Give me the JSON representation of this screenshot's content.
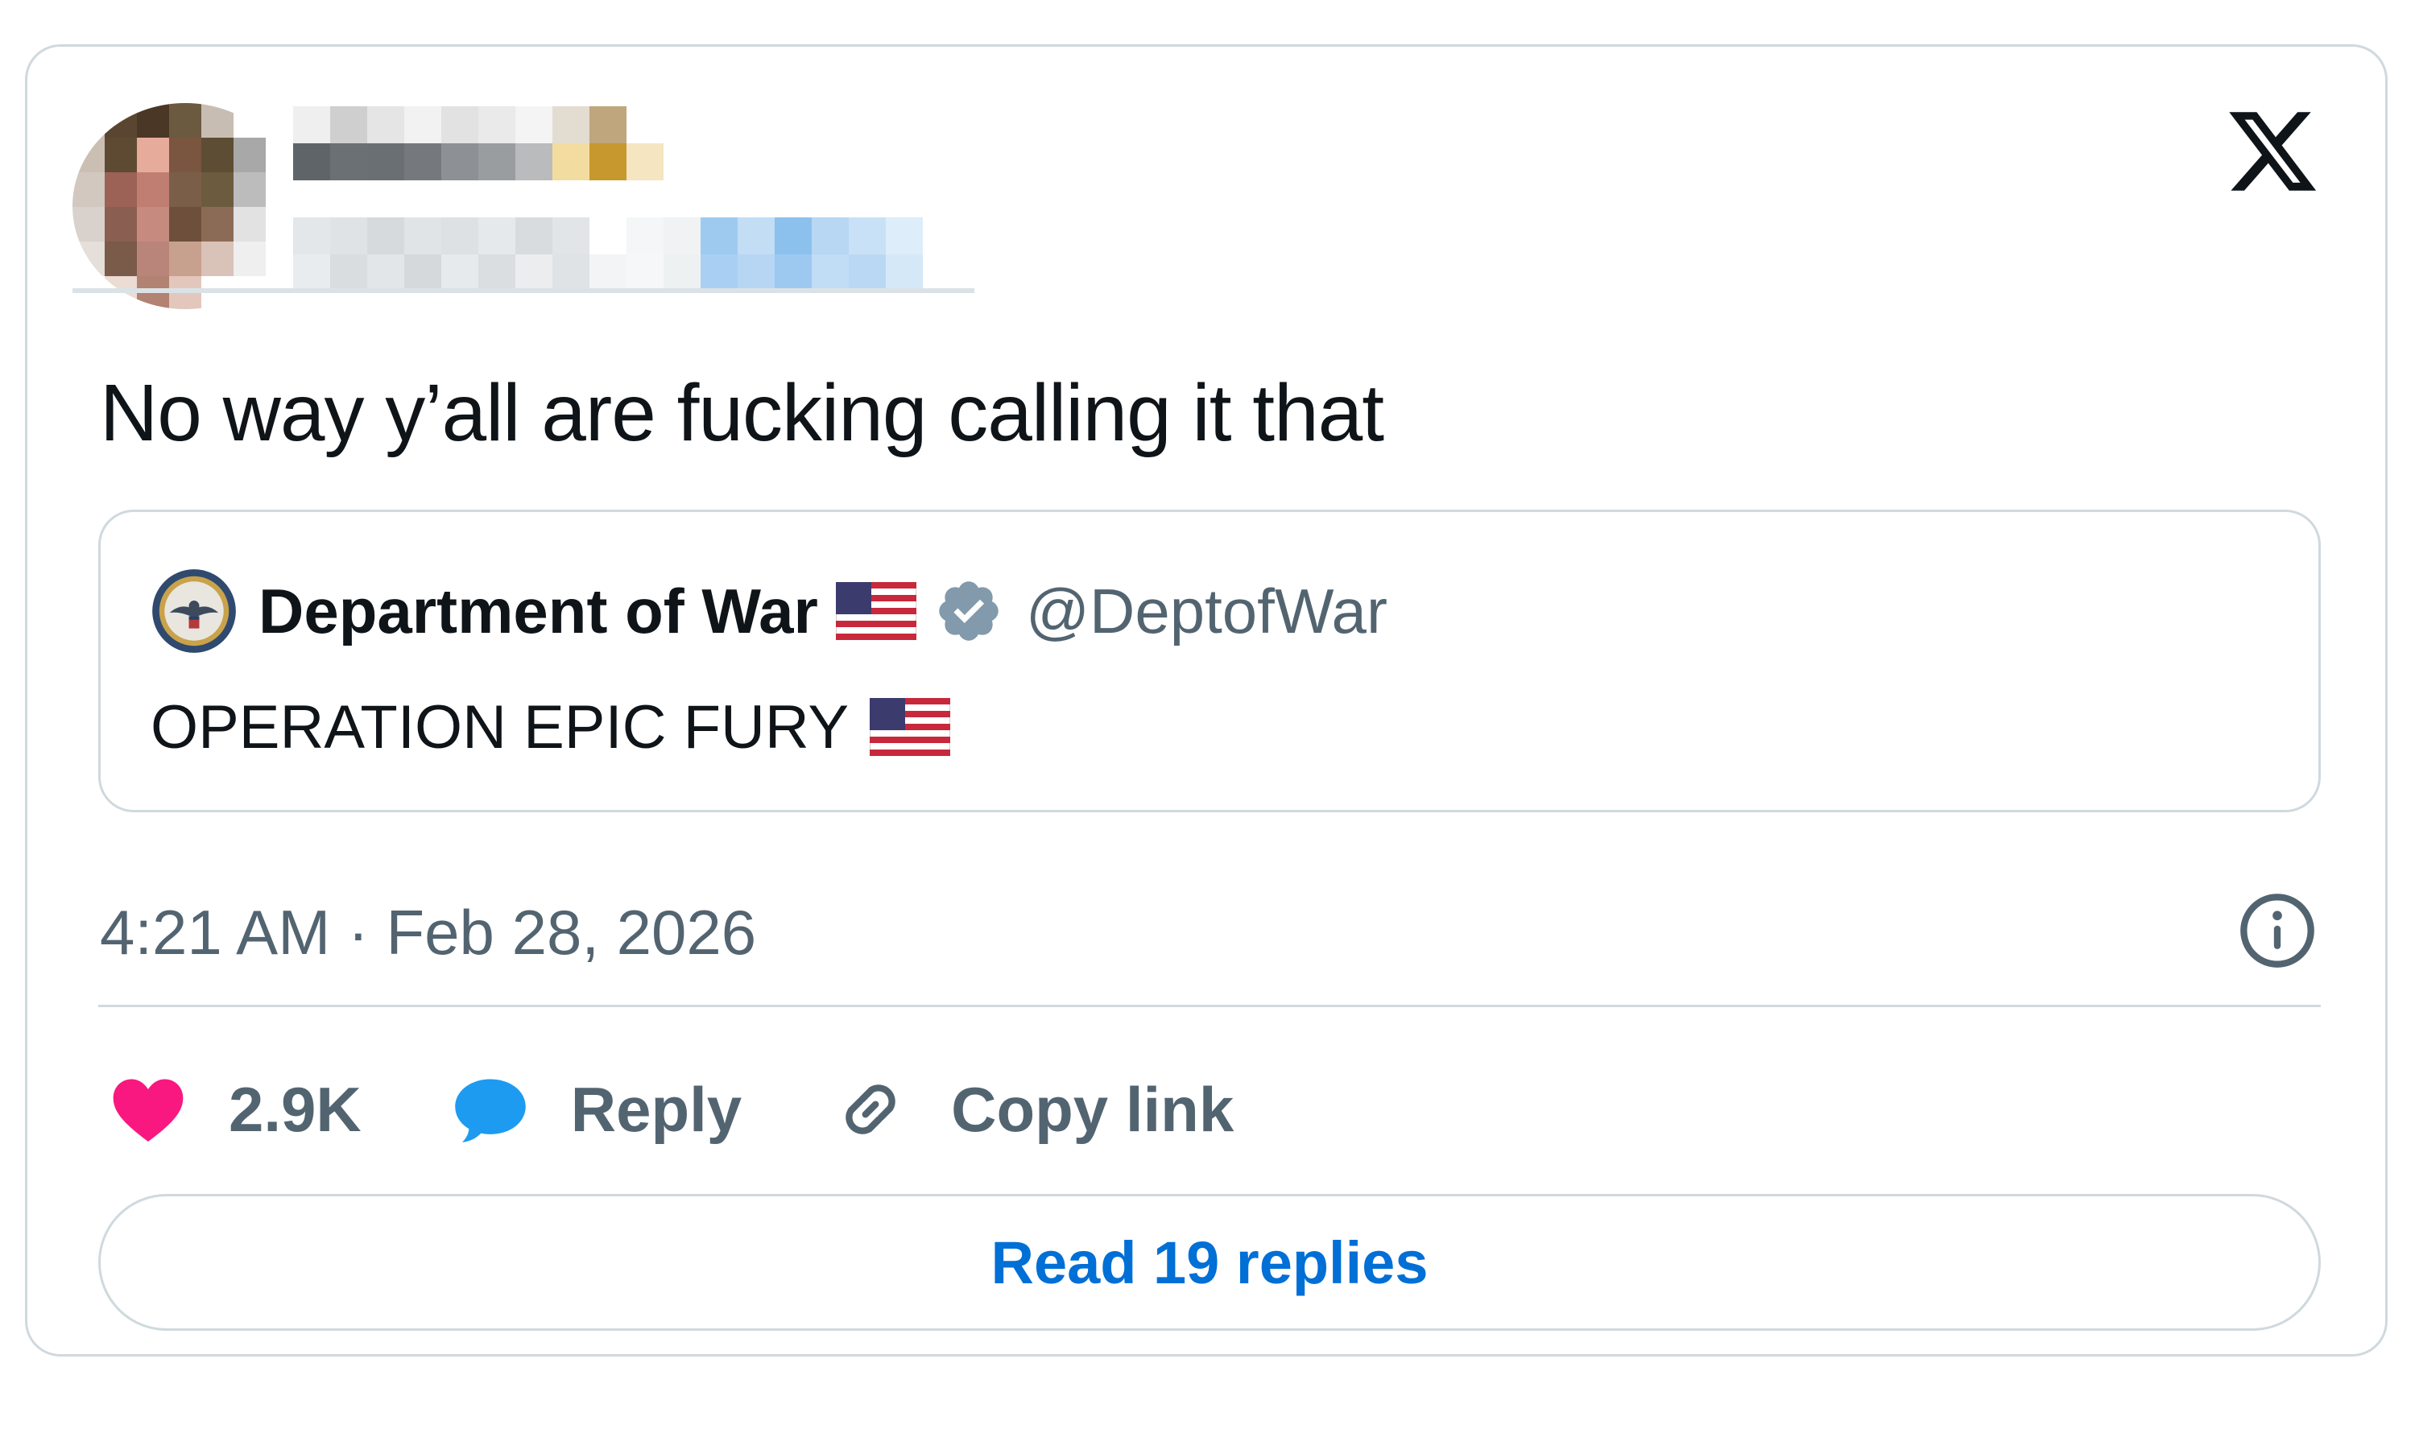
{
  "author": {
    "avatar_pixels": [
      "#c9bfb6",
      "#5a4630",
      "#4b3726",
      "#6b5a40",
      "#c8bdb2",
      "#ffffff",
      "#ffffff",
      "#cbbfb4",
      "#5e4a33",
      "#e6ab9a",
      "#7a5540",
      "#5d4d34",
      "#a8a8a8",
      "#ffffff",
      "#d2c8bf",
      "#9c6256",
      "#c07e72",
      "#7b5e48",
      "#6c5b3e",
      "#bcbcbc",
      "#ffffff",
      "#d9d1cb",
      "#8a5f52",
      "#c68a7e",
      "#6e4f3c",
      "#8c6b56",
      "#e2e2e2",
      "#ffffff",
      "#e5ded9",
      "#7a5a48",
      "#b9857a",
      "#c8a08e",
      "#d9c2b8",
      "#efefef",
      "#ffffff",
      "#ffffff",
      "#ecdcd4",
      "#b28272",
      "#e3c6bc",
      "#ffffff",
      "#ffffff",
      "#ffffff"
    ],
    "name_pixels": [
      "#efefef",
      "#cfcfcf",
      "#e5e5e5",
      "#f2f2f2",
      "#e2e2e2",
      "#eaeaea",
      "#f4f4f4",
      "#e3dcd0",
      "#bfa67c",
      "#ffffff",
      "#5f6468",
      "#6b7075",
      "#6a6f74",
      "#75797d",
      "#8d9094",
      "#9a9da0",
      "#b9bbbd",
      "#f2dca0",
      "#c7982d",
      "#f5e5c0"
    ],
    "handle_pixels": [
      "#e4e7e9",
      "#dfe3e5",
      "#d6dadd",
      "#e1e4e6",
      "#dde1e3",
      "#e6e9eb",
      "#d8dcdf",
      "#e2e5e7",
      "#ffffff",
      "#f4f6f7",
      "#f0f2f3",
      "#9fcaf0",
      "#c3ddf5",
      "#8cc1ee",
      "#b7d7f3",
      "#c9e1f6",
      "#ddedfa",
      "#ffffff",
      "#e9ecee",
      "#d9dde0",
      "#e3e6e8",
      "#d5d9dc",
      "#e7eaec",
      "#dadee1",
      "#ebedef",
      "#e0e3e5",
      "#f2f4f5",
      "#f6f7f8",
      "#eef1f2",
      "#a9d0f2",
      "#b6d6f4",
      "#9dc9f0",
      "#c1dcf5",
      "#bad8f4",
      "#d4e8f8",
      "#ffffff"
    ]
  },
  "tweet": {
    "text": "No way y’all are fucking calling it that",
    "timestamp": "4:21 AM · Feb 28, 2026"
  },
  "quote": {
    "name": "Department of War",
    "handle": "@DeptofWar",
    "text": "OPERATION EPIC FURY"
  },
  "actions": {
    "likes": "2.9K",
    "reply_label": "Reply",
    "copy_link_label": "Copy link",
    "read_replies_label": "Read 19 replies"
  },
  "colors": {
    "like": "#f91880",
    "reply": "#1d9bf0",
    "link_text": "#006fd6",
    "secondary_text": "#536471",
    "border": "#cfd9de"
  },
  "icons": {
    "logo": "x-logo-icon",
    "seal": "dept-seal-icon",
    "flag": "us-flag-icon",
    "verified": "verified-badge-icon",
    "info": "info-icon",
    "like": "heart-icon",
    "reply": "reply-bubble-icon",
    "copy": "link-icon"
  }
}
